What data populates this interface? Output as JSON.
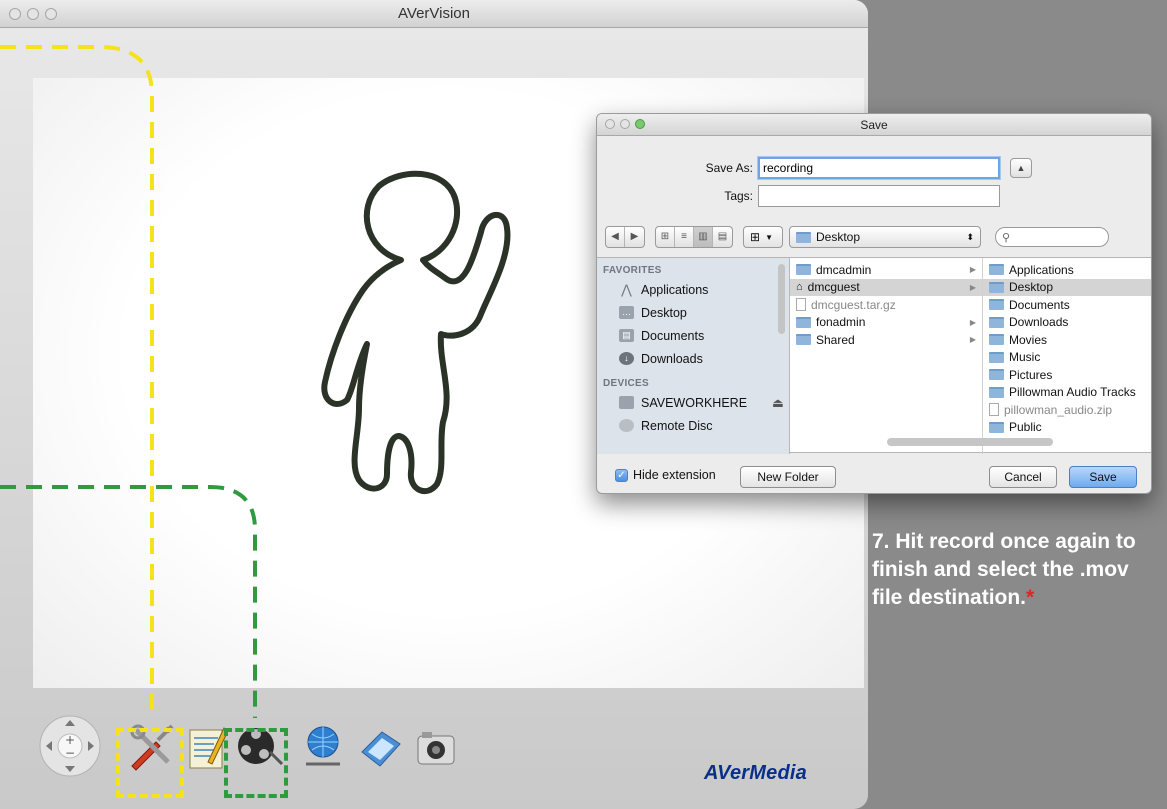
{
  "app": {
    "title": "AVerVision",
    "brand": "AVerMedia"
  },
  "toolbar": {
    "icons": [
      "zoom-pad-icon",
      "settings-tools-icon",
      "annotation-icon",
      "record-icon",
      "network-icon",
      "gallery-icon",
      "camera-icon"
    ]
  },
  "callouts": {
    "yellow": "#f5e21a",
    "green": "#2e9b3f"
  },
  "dialog": {
    "title": "Save",
    "save_as_label": "Save As:",
    "save_as_value": "recording",
    "tags_label": "Tags:",
    "tags_value": "",
    "location": "Desktop",
    "sidebar": {
      "favorites_header": "FAVORITES",
      "favorites": [
        "Applications",
        "Desktop",
        "Documents",
        "Downloads"
      ],
      "devices_header": "DEVICES",
      "devices": [
        "SAVEWORKHERE",
        "Remote Disc"
      ]
    },
    "column1": [
      {
        "name": "dmcadmin",
        "kind": "folder",
        "arrow": true
      },
      {
        "name": "dmcguest",
        "kind": "home",
        "arrow": true,
        "selected": true
      },
      {
        "name": "dmcguest.tar.gz",
        "kind": "file",
        "dim": true
      },
      {
        "name": "fonadmin",
        "kind": "folder",
        "arrow": true
      },
      {
        "name": "Shared",
        "kind": "folder",
        "arrow": true
      }
    ],
    "column2": [
      {
        "name": "Applications"
      },
      {
        "name": "Desktop",
        "selected": true
      },
      {
        "name": "Documents"
      },
      {
        "name": "Downloads"
      },
      {
        "name": "Movies"
      },
      {
        "name": "Music"
      },
      {
        "name": "Pictures"
      },
      {
        "name": "Pillowman Audio Tracks"
      },
      {
        "name": "pillowman_audio.zip",
        "dim": true,
        "kind": "file"
      },
      {
        "name": "Public"
      }
    ],
    "hide_extension_label": "Hide extension",
    "hide_extension_checked": true,
    "new_folder_label": "New Folder",
    "cancel_label": "Cancel",
    "save_label": "Save"
  },
  "instruction": {
    "number": "7.",
    "text": "Hit record once again to finish and select the .mov file destination.",
    "asterisk": "*"
  }
}
